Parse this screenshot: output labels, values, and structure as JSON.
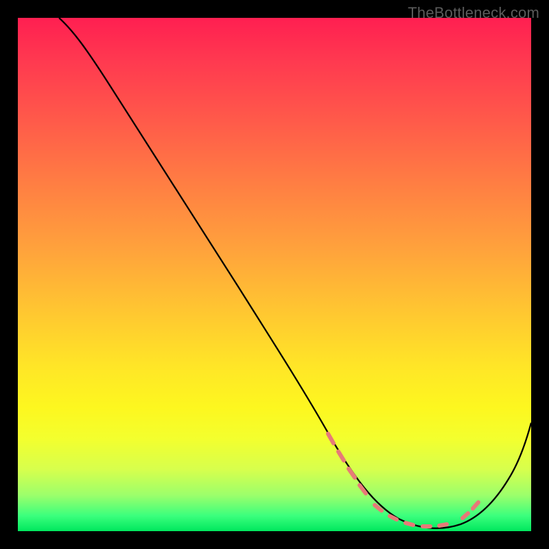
{
  "watermark": "TheBottleneck.com",
  "chart_data": {
    "type": "line",
    "title": "",
    "xlabel": "",
    "ylabel": "",
    "xlim": [
      0,
      100
    ],
    "ylim": [
      0,
      100
    ],
    "grid": false,
    "legend": false,
    "series": [
      {
        "name": "curve",
        "color": "#000000",
        "x": [
          8,
          12,
          18,
          28,
          40,
          52,
          60,
          64,
          68,
          72,
          76,
          80,
          84,
          88,
          92,
          96,
          100
        ],
        "values": [
          100,
          98,
          93,
          80,
          62,
          44,
          32,
          25,
          17,
          10,
          5,
          2,
          1,
          2,
          6,
          13,
          22
        ]
      }
    ],
    "markers": {
      "name": "dashed-region",
      "color": "#e86a6a",
      "x_start": 60,
      "x_end": 88,
      "style": "dashed-dots"
    },
    "gradient_stops": [
      {
        "pos": 0,
        "color": "#ff1f51"
      },
      {
        "pos": 20,
        "color": "#ff5a4a"
      },
      {
        "pos": 45,
        "color": "#ffa23c"
      },
      {
        "pos": 68,
        "color": "#ffe627"
      },
      {
        "pos": 88,
        "color": "#d7ff4d"
      },
      {
        "pos": 100,
        "color": "#00e75e"
      }
    ]
  }
}
